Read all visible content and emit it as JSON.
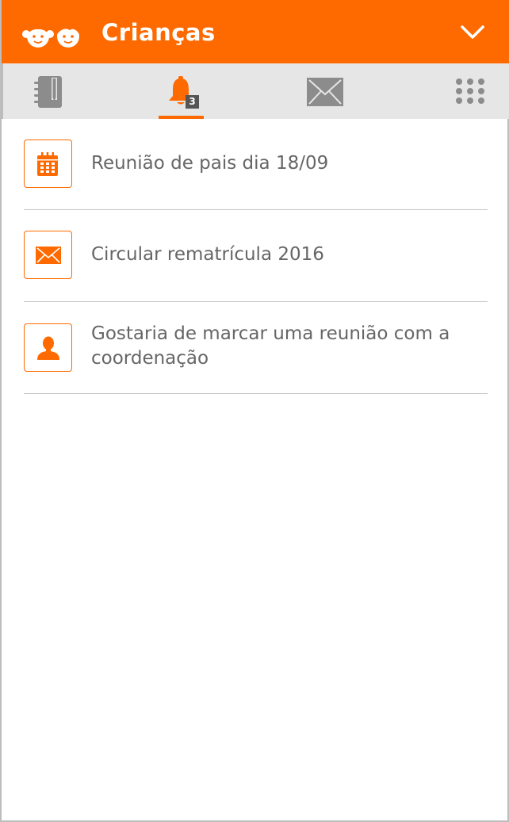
{
  "header": {
    "title": "Crianças",
    "logo_icon": "two-kids-faces-icon",
    "dropdown_icon": "chevron-down-icon"
  },
  "tabs": [
    {
      "name": "agenda",
      "icon": "notebook-pencil-icon",
      "active": false
    },
    {
      "name": "notifications",
      "icon": "bell-icon",
      "active": true,
      "badge": "3"
    },
    {
      "name": "messages",
      "icon": "envelope-icon",
      "active": false
    },
    {
      "name": "menu",
      "icon": "grid-dots-icon",
      "active": false
    }
  ],
  "notifications": [
    {
      "icon": "calendar-icon",
      "text": "Reunião de pais dia 18/09"
    },
    {
      "icon": "envelope-icon",
      "text": "Circular rematrícula 2016"
    },
    {
      "icon": "person-icon",
      "text": "Gostaria de marcar uma reunião com a coordenação"
    }
  ],
  "colors": {
    "accent": "#ff6a00",
    "tabbar_bg": "#e6e6e6",
    "text": "#666666",
    "icon_gray": "#8c8c8c"
  }
}
